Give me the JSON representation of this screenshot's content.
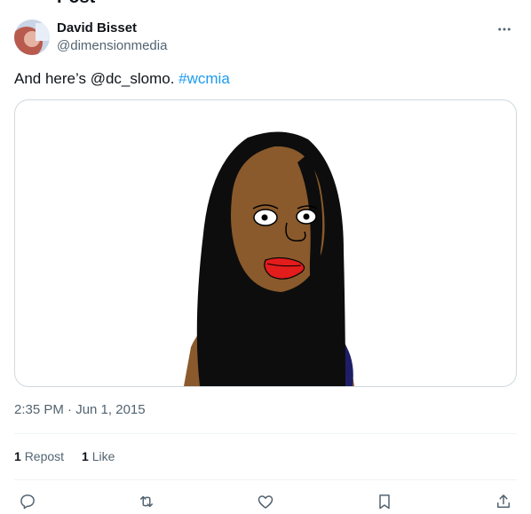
{
  "header": {
    "title_fragment": "Post"
  },
  "author": {
    "display_name": "David Bisset",
    "handle": "@dimensionmedia"
  },
  "tweet": {
    "text": "And here’s @dc_slomo. ",
    "hashtag": "#wcmia"
  },
  "meta": {
    "timestamp": "2:35 PM · Jun 1, 2015"
  },
  "stats": {
    "reposts_count": "1",
    "reposts_label": "Repost",
    "likes_count": "1",
    "likes_label": "Like"
  },
  "actions": {
    "icons": [
      "reply-icon",
      "repost-icon",
      "like-icon",
      "bookmark-icon",
      "share-icon"
    ]
  },
  "colors": {
    "link": "#1d9bf0",
    "secondary_text": "#536471",
    "border": "#cfd9de"
  }
}
